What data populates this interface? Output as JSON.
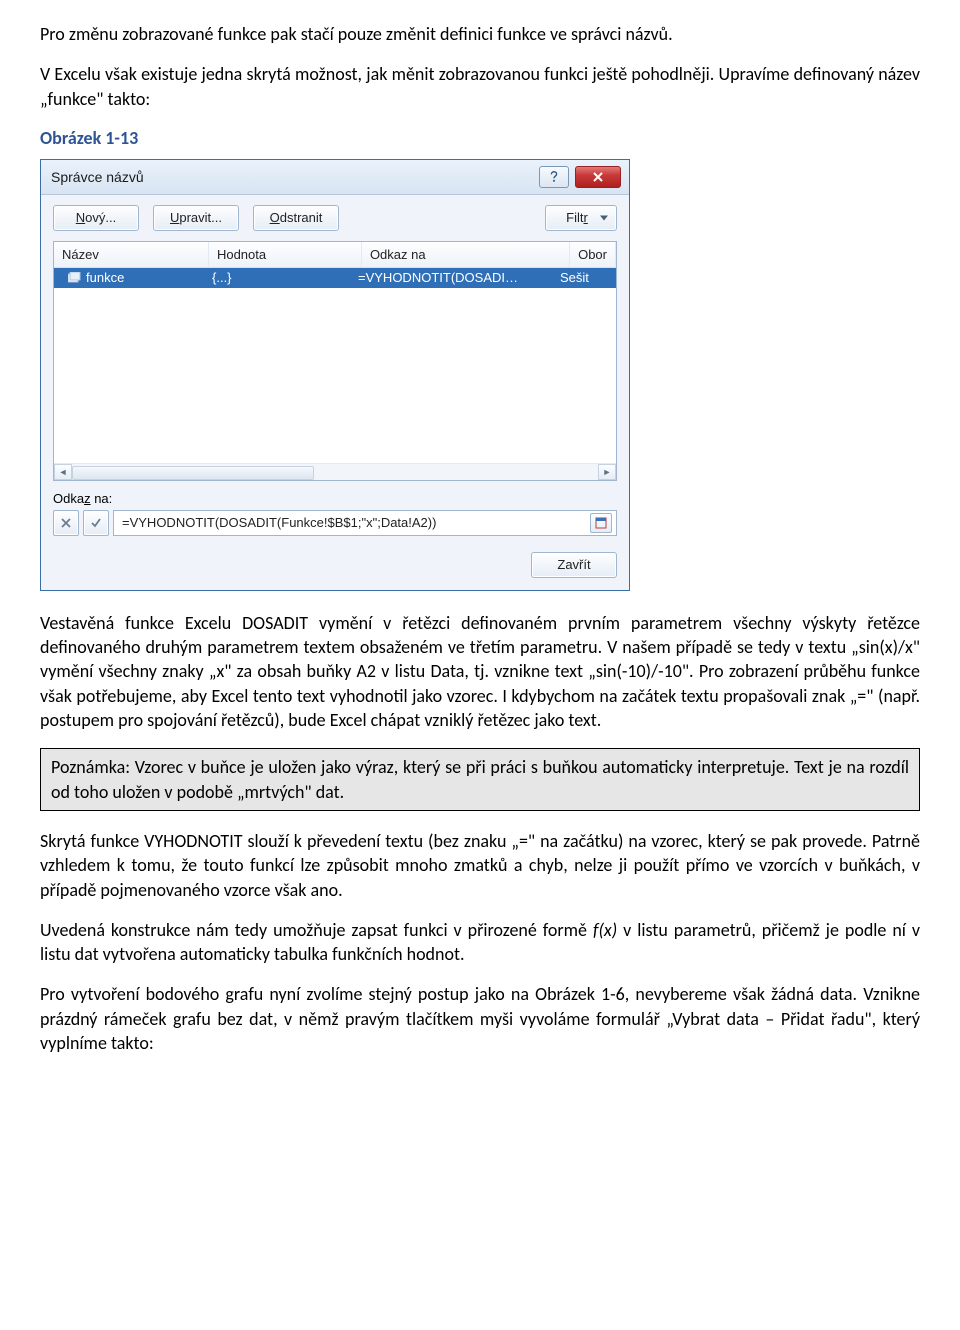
{
  "para1": "Pro změnu zobrazované funkce pak stačí pouze změnit definici funkce ve správci názvů.",
  "para2": "V Excelu však existuje jedna skrytá možnost, jak měnit zobrazovanou funkci ještě pohodlněji. Upravíme definovaný název „funkce\" takto:",
  "fig_label": "Obrázek 1-13",
  "dialog": {
    "title": "Správce názvů",
    "buttons": {
      "new": "Nový...",
      "edit": "Upravit...",
      "delete": "Odstranit",
      "filter": "Filtr",
      "close": "Zavřít"
    },
    "columns": {
      "name": "Název",
      "value": "Hodnota",
      "refersTo": "Odkaz na",
      "scope": "Obor"
    },
    "row": {
      "name": "funkce",
      "value": "{...}",
      "refersTo": "=VYHODNOTIT(DOSADI…",
      "scope": "Sešit"
    },
    "refers_label": "Odkaz na:",
    "refers_value": "=VYHODNOTIT(DOSADIT(Funkce!$B$1;\"x\";Data!A2))"
  },
  "para3": "Vestavěná funkce Excelu DOSADIT vymění v řetězci definovaném prvním parametrem všechny výskyty řetězce definovaného druhým parametrem textem obsaženém ve třetím parametru. V našem případě se tedy v textu „sin(x)/x\" vymění všechny znaky „x\" za obsah buňky A2 v listu Data, tj. vznikne text „sin(-10)/-10\". Pro zobrazení průběhu funkce však potřebujeme, aby Excel tento text vyhodnotil jako vzorec. I kdybychom na začátek textu propašovali znak „=\" (např. postupem pro spojování řetězců), bude Excel chápat vzniklý řetězec jako text.",
  "note": "Poznámka: Vzorec v buňce je uložen jako výraz, který se při práci s buňkou automaticky interpretuje. Text je na rozdíl od toho uložen v podobě „mrtvých\" dat.",
  "para4": "Skrytá funkce VYHODNOTIT slouží k převedení textu (bez znaku „=\" na začátku) na vzorec, který se pak provede. Patrně vzhledem k tomu, že touto funkcí lze způsobit mnoho zmatků a chyb, nelze ji použít přímo ve vzorcích v buňkách, v případě pojmenovaného vzorce však ano.",
  "para5a": "Uvedená konstrukce nám tedy umožňuje zapsat funkci v přirozené formě ",
  "para5b": "f(x)",
  "para5c": " v listu parametrů, přičemž je podle ní v listu dat vytvořena automaticky tabulka funkčních hodnot.",
  "para6": "Pro vytvoření bodového grafu nyní zvolíme stejný postup jako na Obrázek 1-6, nevybereme však žádná data. Vznikne prázdný rámeček grafu bez dat, v němž pravým tlačítkem myši vyvoláme formulář „Vybrat data – Přidat řadu\", který vyplníme takto:"
}
